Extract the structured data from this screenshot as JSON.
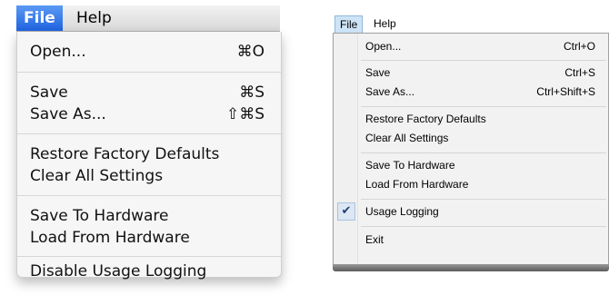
{
  "mac_menu": {
    "menubar": {
      "file": "File",
      "help": "Help"
    },
    "items": [
      {
        "label": "Open...",
        "shortcut": "⌘O"
      },
      {
        "label": "Save",
        "shortcut": "⌘S"
      },
      {
        "label": "Save As...",
        "shortcut": "⇧⌘S"
      },
      {
        "label": "Restore Factory Defaults",
        "shortcut": ""
      },
      {
        "label": "Clear All Settings",
        "shortcut": ""
      },
      {
        "label": "Save To Hardware",
        "shortcut": ""
      },
      {
        "label": "Load From Hardware",
        "shortcut": ""
      },
      {
        "label": "Disable Usage Logging",
        "shortcut": ""
      }
    ]
  },
  "win_menu": {
    "menubar": {
      "file": "File",
      "help": "Help"
    },
    "items": [
      {
        "label": "Open...",
        "shortcut": "Ctrl+O"
      },
      {
        "label": "Save",
        "shortcut": "Ctrl+S"
      },
      {
        "label": "Save As...",
        "shortcut": "Ctrl+Shift+S"
      },
      {
        "label": "Restore Factory Defaults",
        "shortcut": ""
      },
      {
        "label": "Clear All Settings",
        "shortcut": ""
      },
      {
        "label": "Save To Hardware",
        "shortcut": ""
      },
      {
        "label": "Load From Hardware",
        "shortcut": ""
      },
      {
        "label": "Usage Logging",
        "shortcut": "",
        "checked": true,
        "check_icon": "checkmark-icon",
        "check_glyph": "✔"
      },
      {
        "label": "Exit",
        "shortcut": ""
      }
    ]
  },
  "colors": {
    "mac_highlight": "#2a6fe6",
    "win_highlight": "#cde3f6"
  }
}
